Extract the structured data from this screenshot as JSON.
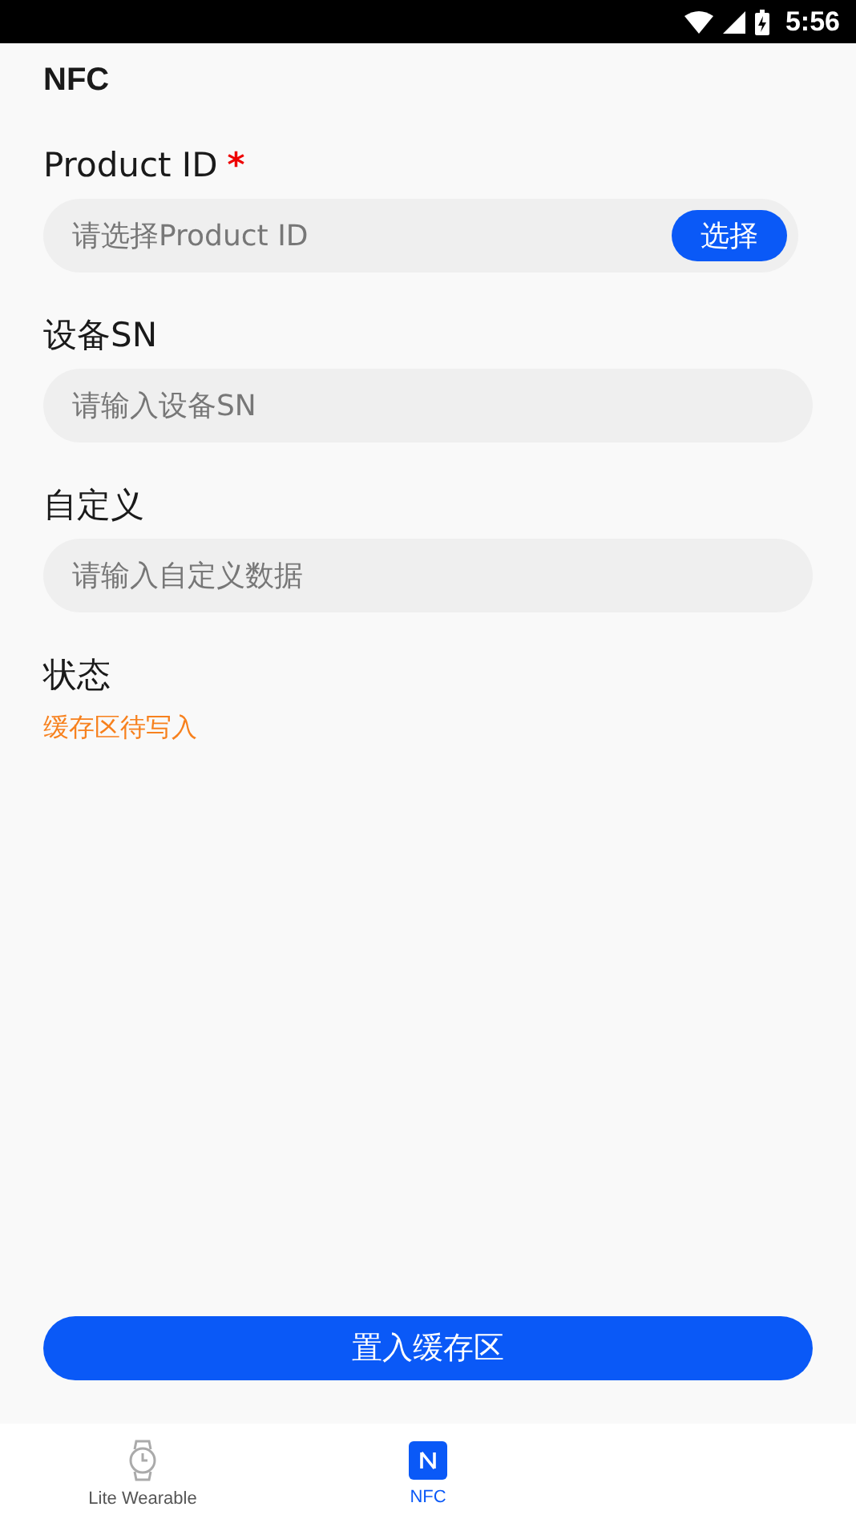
{
  "status_bar": {
    "time": "5:56"
  },
  "title": "NFC",
  "fields": [
    {
      "kind": "select",
      "label": "Product ID",
      "required_mark": "*",
      "placeholder": "请选择Product ID",
      "button": "选择"
    },
    {
      "kind": "input",
      "label": "设备SN",
      "placeholder": "请输入设备SN"
    },
    {
      "kind": "input",
      "label": "自定义",
      "placeholder": "请输入自定义数据"
    }
  ],
  "status": {
    "label": "状态",
    "value": "缓存区待写入"
  },
  "primary_button": "置入缓存区",
  "tabs": [
    {
      "label": "Lite Wearable",
      "kind": "watch",
      "selected": false
    },
    {
      "label": "NFC",
      "kind": "nfc",
      "selected": true
    }
  ]
}
